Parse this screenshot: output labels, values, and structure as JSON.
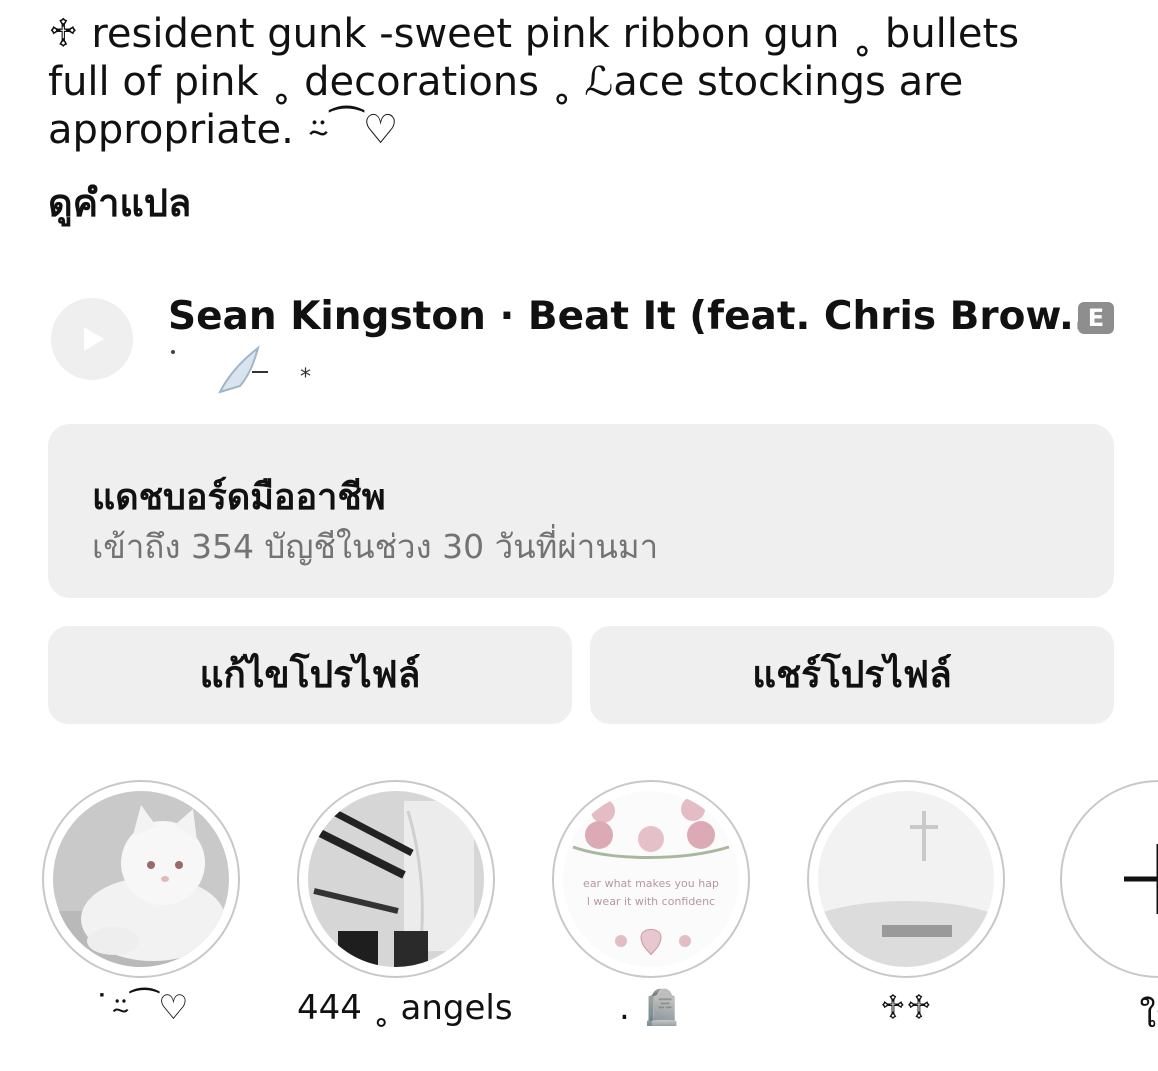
{
  "bio": {
    "text": "   ♱ resident gunk -sweet pink ribbon gun ˳ bullets\nfull of pink ˳ decorations ˳ ℒace stockings are\nappropriate. ⍨⁀♡",
    "translate_label": "ดูคำแปล"
  },
  "music": {
    "song": "Sean Kingston · Beat It (feat. Chris Brow...",
    "explicit_badge": "E",
    "subtitle": "˙ ⟋ *",
    "play_icon": "play-icon"
  },
  "dashboard": {
    "title": "แดชบอร์ดมืออาชีพ",
    "subtitle": "เข้าถึง 354 บัญชีในช่วง 30 วันที่ผ่านมา"
  },
  "buttons": {
    "edit_profile": "แก้ไขโปรไฟล์",
    "share_profile": "แชร์โปรไฟล์"
  },
  "highlights": [
    {
      "label": "˙⍨⁀♡",
      "thumb": "white-kitten"
    },
    {
      "label": "444 ˳ angels",
      "thumb": "lace-clothes"
    },
    {
      "label": ". 🪦",
      "thumb": "roses-quote",
      "overlay": "ear what makes you hap\nl wear it with confidenc"
    },
    {
      "label": "♱♱",
      "thumb": "misty-cross"
    },
    {
      "label": "ให",
      "thumb": "new-plus"
    }
  ],
  "colors": {
    "button_bg": "#efefef",
    "subtle_text": "#737373",
    "ring": "#c8c8c8",
    "explicit_bg": "#8e8e8e"
  }
}
